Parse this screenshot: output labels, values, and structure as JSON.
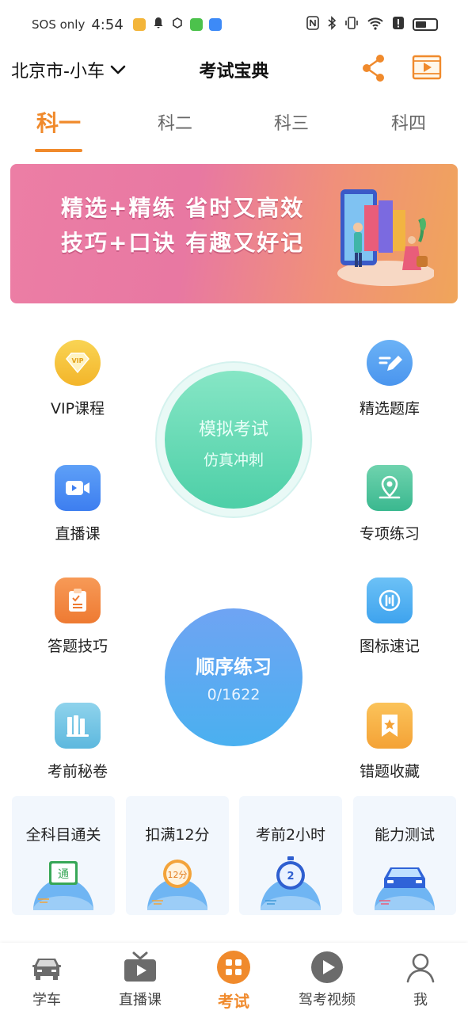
{
  "status_bar": {
    "carrier": "SOS only",
    "time": "4:54",
    "battery_level": 0.55
  },
  "header": {
    "city": "北京市-小车",
    "title": "考试宝典"
  },
  "tabs": [
    {
      "label": "科一",
      "active": true
    },
    {
      "label": "科二",
      "active": false
    },
    {
      "label": "科三",
      "active": false
    },
    {
      "label": "科四",
      "active": false
    }
  ],
  "banner": {
    "line1": "精选+精练  省时又高效",
    "line2": "技巧+口诀  有趣又好记"
  },
  "features": {
    "vip": "VIP课程",
    "question_bank": "精选题库",
    "live": "直播课",
    "special": "专项练习",
    "tips": "答题技巧",
    "signs": "图标速记",
    "secret": "考前秘卷",
    "mistakes": "错题收藏"
  },
  "mock_exam": {
    "title": "模拟考试",
    "subtitle": "仿真冲刺"
  },
  "sequential": {
    "title": "顺序练习",
    "progress": "0/1622"
  },
  "cards": [
    {
      "label": "全科目通关",
      "badge": "通"
    },
    {
      "label": "扣满12分",
      "badge": "12分"
    },
    {
      "label": "考前2小时",
      "badge": "2"
    },
    {
      "label": "能力测试",
      "badge": ""
    }
  ],
  "bottom_nav": [
    {
      "label": "学车",
      "icon": "car-icon"
    },
    {
      "label": "直播课",
      "icon": "tv-icon"
    },
    {
      "label": "考试",
      "icon": "exam-grid-icon",
      "active": true
    },
    {
      "label": "驾考视频",
      "icon": "play-icon"
    },
    {
      "label": "我",
      "icon": "person-icon"
    }
  ],
  "colors": {
    "accent": "#f08a2c",
    "mint": "#4dcfa7",
    "blue": "#5aa8f2"
  }
}
